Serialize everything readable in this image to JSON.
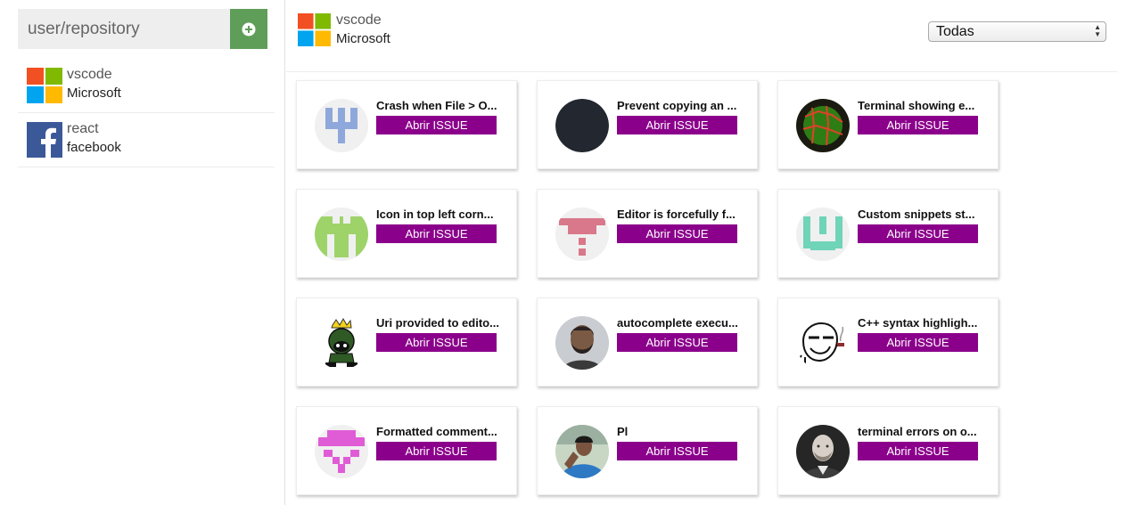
{
  "sidebar": {
    "repo_input": {
      "placeholder": "user/repository",
      "value": ""
    },
    "add_icon": "plus-circle-icon",
    "repos": [
      {
        "name": "vscode",
        "owner": "Microsoft",
        "logo": "microsoft-logo"
      },
      {
        "name": "react",
        "owner": "facebook",
        "logo": "facebook-logo"
      }
    ]
  },
  "header": {
    "repo_name": "vscode",
    "repo_owner": "Microsoft",
    "logo": "microsoft-logo",
    "filter": {
      "selected": "Todas"
    }
  },
  "colors": {
    "button": "#8b008b",
    "add_button": "#5f9e58",
    "microsoft": [
      "#f25022",
      "#7fba00",
      "#00a4ef",
      "#ffb900"
    ],
    "facebook": "#3b5998"
  },
  "issues": [
    {
      "title": "Crash when File > O...",
      "button": "Abrir ISSUE",
      "avatar": "identicon-blue"
    },
    {
      "title": "Prevent copying an ...",
      "button": "Abrir ISSUE",
      "avatar": "dark-circle"
    },
    {
      "title": "Terminal showing e...",
      "button": "Abrir ISSUE",
      "avatar": "green-glow-avatar"
    },
    {
      "title": "Icon in top left corn...",
      "button": "Abrir ISSUE",
      "avatar": "identicon-green"
    },
    {
      "title": "Editor is forcefully f...",
      "button": "Abrir ISSUE",
      "avatar": "identicon-pink"
    },
    {
      "title": "Custom snippets st...",
      "button": "Abrir ISSUE",
      "avatar": "identicon-teal"
    },
    {
      "title": "Uri provided to edito...",
      "button": "Abrir ISSUE",
      "avatar": "marvin-martian"
    },
    {
      "title": "autocomplete execu...",
      "button": "Abrir ISSUE",
      "avatar": "photo-bearded-man"
    },
    {
      "title": "C++ syntax highligh...",
      "button": "Abrir ISSUE",
      "avatar": "meme-face"
    },
    {
      "title": "Formatted comment...",
      "button": "Abrir ISSUE",
      "avatar": "identicon-magenta"
    },
    {
      "title": "Pl",
      "button": "Abrir ISSUE",
      "avatar": "photo-man-blue-shirt"
    },
    {
      "title": "terminal errors on o...",
      "button": "Abrir ISSUE",
      "avatar": "photo-bald-man"
    }
  ]
}
